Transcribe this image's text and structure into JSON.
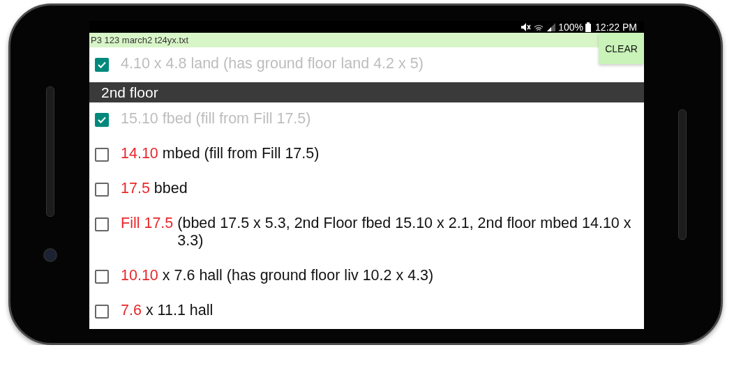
{
  "status_bar": {
    "battery": "100%",
    "time": "12:22 PM"
  },
  "file_bar": {
    "filename": "P3 123 march2 t24yx.txt",
    "clear_button": "CLEAR"
  },
  "items": [
    {
      "kind": "item",
      "checked": true,
      "text": "4.10 x 4.8 land (has ground floor land 4.2 x 5)"
    },
    {
      "kind": "header",
      "text": "2nd floor"
    },
    {
      "kind": "item",
      "checked": true,
      "text": "15.10 fbed (fill from Fill 17.5)"
    },
    {
      "kind": "item",
      "checked": false,
      "highlight": "14.10",
      "text": "mbed (fill from Fill 17.5)"
    },
    {
      "kind": "item",
      "checked": false,
      "highlight": "17.5",
      "text": "bbed"
    },
    {
      "kind": "item",
      "checked": false,
      "highlight": "Fill 17.5",
      "text": "(bbed 17.5 x 5.3, 2nd Floor fbed 15.10 x 2.1, 2nd floor mbed 14.10 x 3.3)"
    },
    {
      "kind": "item",
      "checked": false,
      "highlight": "10.10",
      "text": "x 7.6 hall (has ground floor liv 10.2 x 4.3)"
    },
    {
      "kind": "item",
      "checked": false,
      "highlight": "7.6",
      "text": "x 11.1 hall"
    }
  ]
}
